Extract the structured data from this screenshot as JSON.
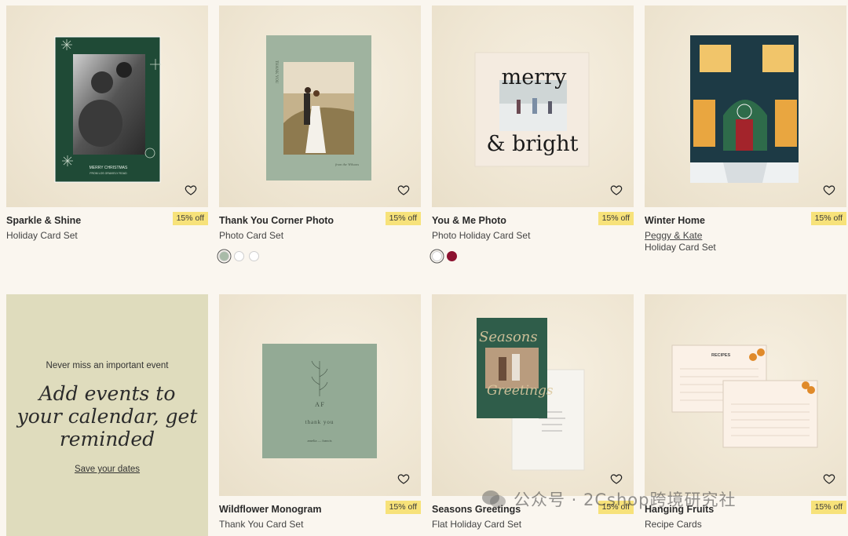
{
  "products": [
    {
      "title": "Sparkle & Shine",
      "subtitle": "Holiday Card Set",
      "badge": "15% off",
      "art": {
        "card_color": "#1f4a36",
        "greeting": "MERRY CHRISTMAS",
        "signoff": "FROM LOS GRAVIELY ROAD"
      }
    },
    {
      "title": "Thank You Corner Photo",
      "subtitle": "Photo Card Set",
      "badge": "15% off",
      "art": {
        "card_color": "#9fb39f",
        "side_text": "THANK YOU",
        "signoff": "from the Wilsons"
      },
      "swatches": [
        "#a9bba8",
        "#ffffff",
        "#ffffff"
      ]
    },
    {
      "title": "You & Me Photo",
      "subtitle": "Photo Holiday Card Set",
      "badge": "15% off",
      "art": {
        "card_color": "#f4ebe0",
        "line1": "merry",
        "line2": "& bright"
      },
      "swatches": [
        "#ffffff",
        "#8c1230"
      ]
    },
    {
      "title": "Winter Home",
      "designer": "Peggy & Kate",
      "subtitle": "Holiday Card Set",
      "badge": "15% off",
      "art": {
        "card_color": "#1d3a45"
      }
    },
    {
      "title": "Wildflower Monogram",
      "subtitle": "Thank You Card Set",
      "badge": "15% off",
      "art": {
        "card_color": "#93aa95",
        "initials": "A  F",
        "line": "thank you",
        "signoff": "amelia — francis"
      }
    },
    {
      "title": "Seasons Greetings",
      "subtitle": "Flat Holiday Card Set",
      "badge": "15% off",
      "art": {
        "card_color": "#2f5d4a",
        "script": "Seasons Greetings"
      }
    },
    {
      "title": "Hanging Fruits",
      "subtitle": "Recipe Cards",
      "badge": "15% off",
      "art": {
        "card_color": "#fbf1e7",
        "heading": "RECIPES"
      }
    }
  ],
  "promo": {
    "kicker": "Never miss an important event",
    "headline_lines": [
      "Add events to",
      "your calendar, get",
      "reminded"
    ],
    "cta": "Save your dates"
  },
  "watermark": "公众号 · 2Cshop跨境研究社",
  "icons": {
    "favorite": "heart-icon"
  }
}
